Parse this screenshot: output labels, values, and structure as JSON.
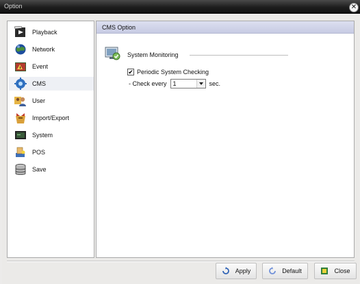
{
  "window": {
    "title": "Option",
    "close_glyph": "✕"
  },
  "sidebar": {
    "items": [
      {
        "label": "Playback",
        "icon": "playback-icon"
      },
      {
        "label": "Network",
        "icon": "network-icon"
      },
      {
        "label": "Event",
        "icon": "event-icon"
      },
      {
        "label": "CMS",
        "icon": "cms-icon",
        "selected": true
      },
      {
        "label": "User",
        "icon": "user-icon"
      },
      {
        "label": "Import/Export",
        "icon": "import-export-icon"
      },
      {
        "label": "System",
        "icon": "system-icon"
      },
      {
        "label": "POS",
        "icon": "pos-icon"
      },
      {
        "label": "Save",
        "icon": "save-icon"
      }
    ]
  },
  "content": {
    "header": "CMS Option",
    "section_title": "System Monitoring",
    "periodic_checkbox": {
      "label": "Periodic System Checking",
      "checked": true,
      "check_mark": "✔"
    },
    "check_every": {
      "prefix": "- Check every",
      "value": "1",
      "suffix": "sec."
    }
  },
  "buttons": {
    "apply": "Apply",
    "default": "Default",
    "close": "Close"
  },
  "colors": {
    "titlebar": "#1e1e1e",
    "header_band": "#c7cbe3",
    "window_bg": "#ebeae8",
    "panel_bg": "#ffffff"
  }
}
